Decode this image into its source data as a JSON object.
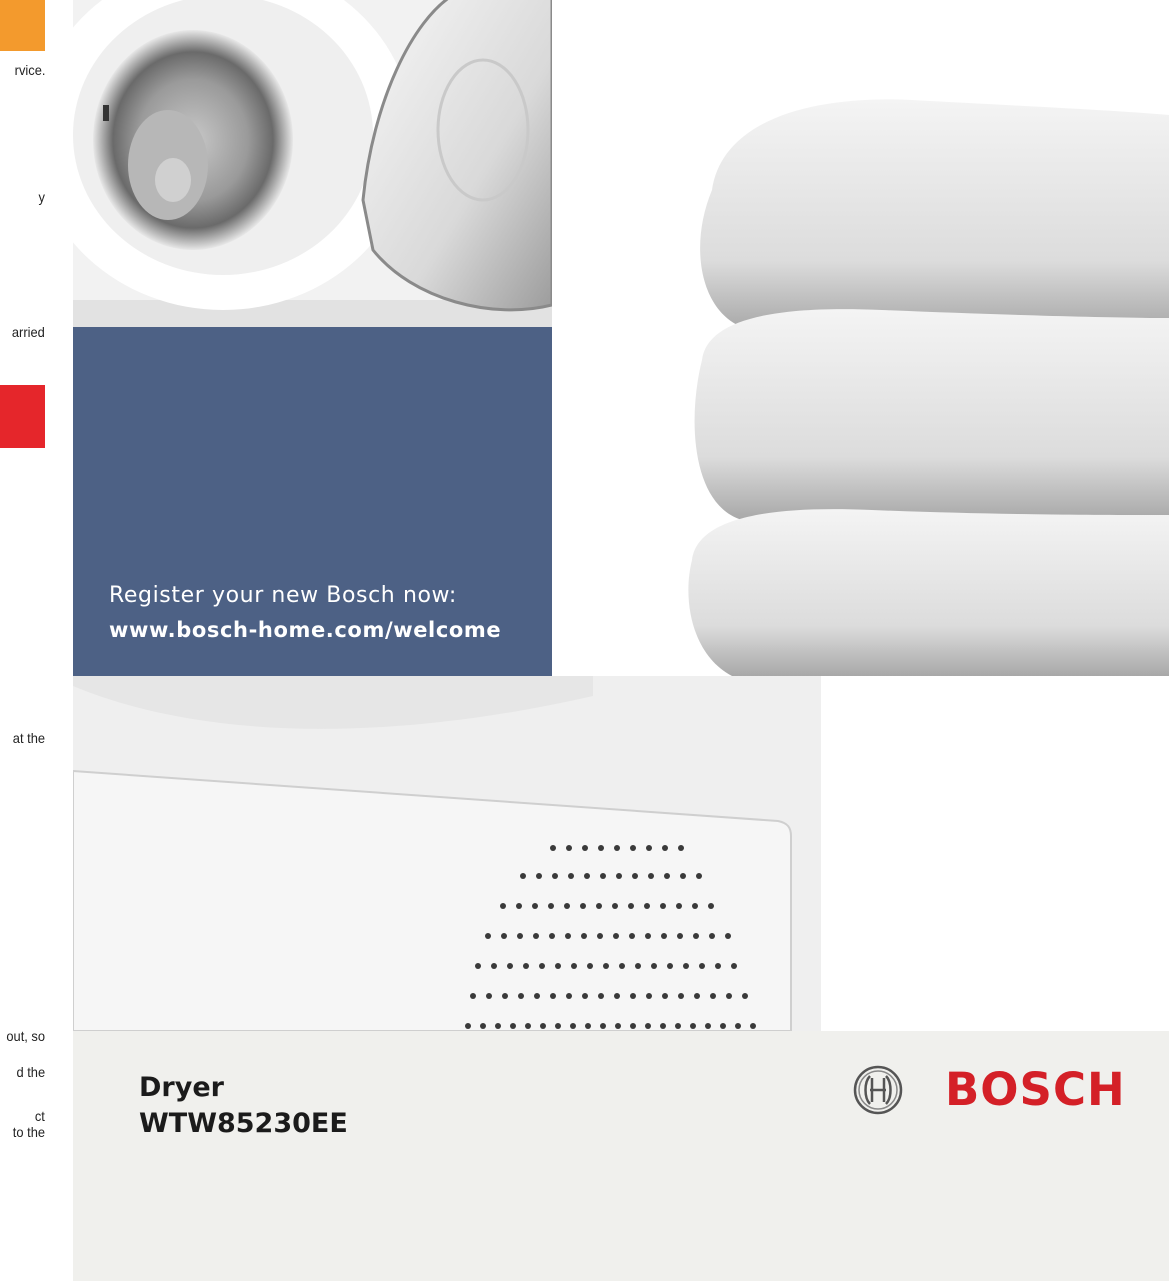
{
  "left_fragments": {
    "line1": "rvice.",
    "line2": "y",
    "line3": "arried",
    "line4": "at the",
    "line5": "out, so",
    "line6": "d the",
    "line7": "ct",
    "line8": "to the"
  },
  "colors": {
    "caution_orange": "#f39a2d",
    "warning_red": "#e5262b",
    "register_panel_blue": "#4d6185",
    "brand_red": "#d42027",
    "product_band": "#f0f0ed"
  },
  "register": {
    "line1": "Register your new Bosch now:",
    "url": "www.bosch-home.com/welcome"
  },
  "product": {
    "type": "Dryer",
    "model": "WTW85230EE"
  },
  "brand": {
    "name": "BOSCH",
    "logo_icon": "bosch-armature-icon"
  },
  "images": {
    "top_left": "dryer-drum-open-door-photo",
    "top_right": "folded-white-towels-photo",
    "middle": "dryer-front-vent-panel-photo"
  }
}
